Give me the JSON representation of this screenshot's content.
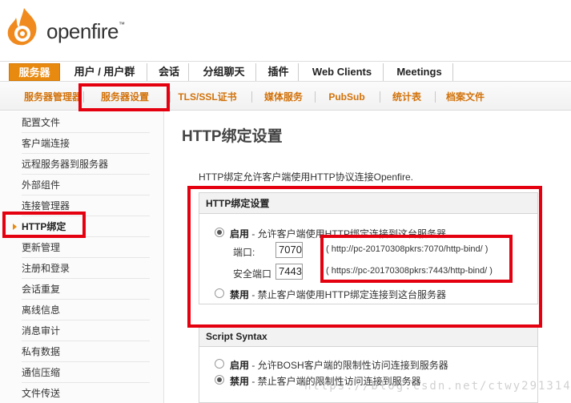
{
  "brand": {
    "name": "openfire"
  },
  "main_nav": [
    "服务器",
    "用户 / 用户群",
    "会话",
    "分组聊天",
    "插件",
    "Web Clients",
    "Meetings"
  ],
  "sub_nav": [
    "服务器管理器",
    "服务器设置",
    "TLS/SSL证书",
    "媒体服务",
    "PubSub",
    "统计表",
    "档案文件"
  ],
  "sidebar": [
    "配置文件",
    "客户端连接",
    "远程服务器到服务器",
    "外部组件",
    "连接管理器",
    "HTTP绑定",
    "更新管理",
    "注册和登录",
    "会话重复",
    "离线信息",
    "消息审计",
    "私有数据",
    "通信压缩",
    "文件传送"
  ],
  "page": {
    "title": "HTTP绑定设置",
    "intro": "HTTP绑定允许客户端使用HTTP协议连接Openfire."
  },
  "http_binding": {
    "header": "HTTP绑定设置",
    "enabled_label": "启用",
    "enabled_desc": " - 允许客户端使用HTTP绑定连接到这台服务器",
    "port_label": "端口:",
    "port_value": "7070",
    "port_url": "( http://pc-20170308pkrs:7070/http-bind/ )",
    "secure_port_label": "安全端口",
    "secure_port_value": "7443",
    "secure_port_url": "( https://pc-20170308pkrs:7443/http-bind/ )",
    "disabled_label": "禁用",
    "disabled_desc": " - 禁止客户端使用HTTP绑定连接到这台服务器",
    "selected": "enabled"
  },
  "script_syntax": {
    "header": "Script Syntax",
    "enabled_label": "启用",
    "enabled_desc": " - 允许BOSH客户端的限制性访问连接到服务器",
    "disabled_label": "禁用",
    "disabled_desc": " - 禁止客户端的限制性访问连接到服务器",
    "selected": "disabled"
  },
  "watermark": "https://blog.csdn.net/ctwy291314",
  "colors": {
    "accent": "#e98a10",
    "highlight": "#e4000f"
  }
}
